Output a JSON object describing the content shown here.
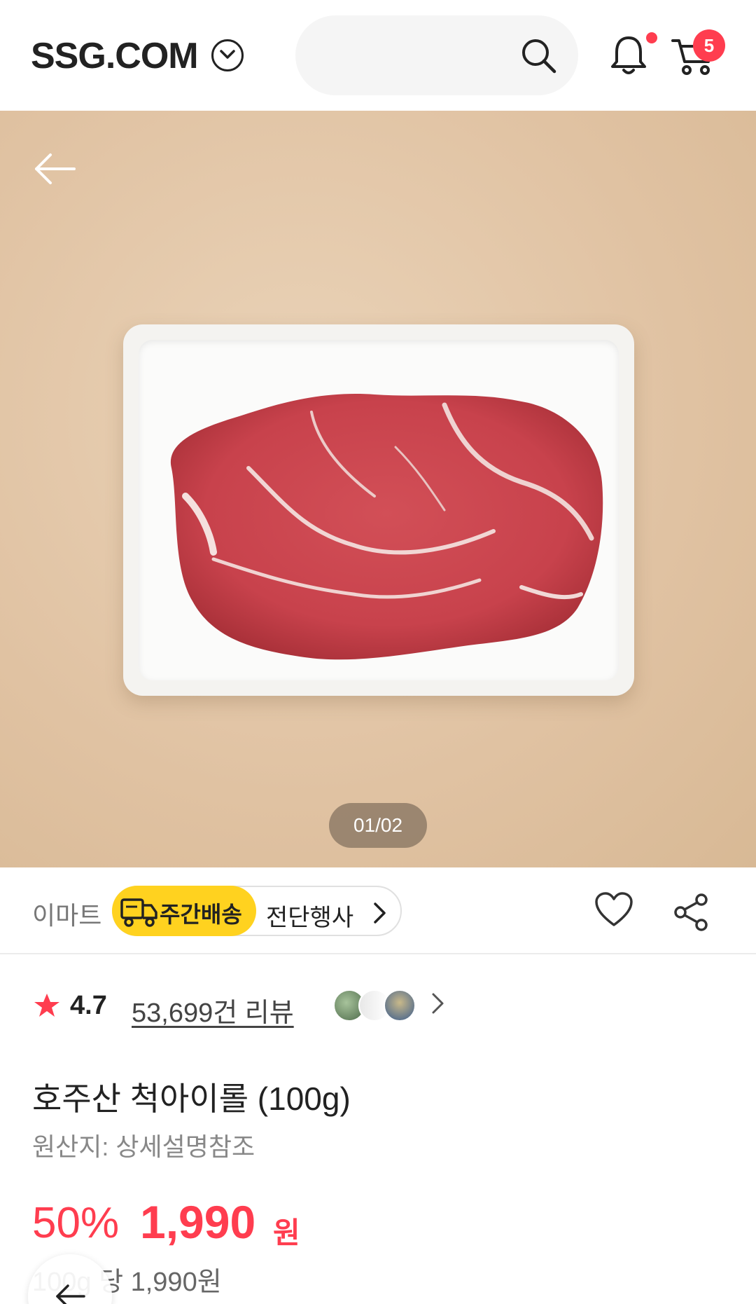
{
  "header": {
    "logo": "SSG.COM",
    "cart_count": "5"
  },
  "hero": {
    "image_counter": "01/02"
  },
  "store": {
    "name": "이마트",
    "delivery_label": "주간배송",
    "delivery_ad": "전단행사"
  },
  "rating": {
    "value": "4.7",
    "review_count": "53,699건 리뷰"
  },
  "product": {
    "title": "호주산 척아이롤 (100g)",
    "origin": "원산지: 상세설명참조"
  },
  "price": {
    "discount": "50%",
    "amount": "1,990",
    "currency": "원",
    "unit_price": "100g 당 1,990원"
  },
  "colors": {
    "accent": "#ff3d4f",
    "delivery_yellow": "#ffd21f"
  }
}
